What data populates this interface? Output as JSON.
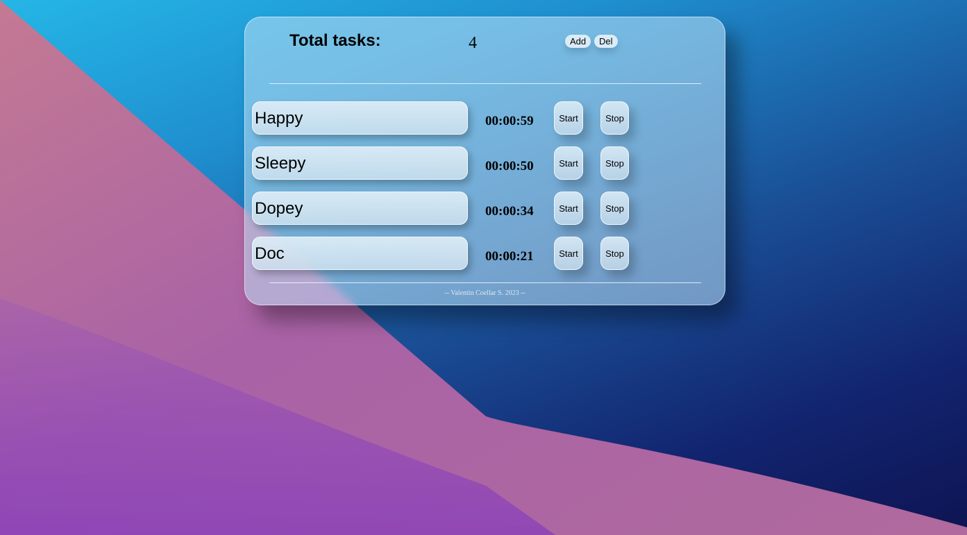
{
  "header": {
    "title": "Total tasks:",
    "count": "4",
    "add_label": "Add",
    "del_label": "Del"
  },
  "tasks": [
    {
      "name": "Happy",
      "time": "00:00:59",
      "start_label": "Start",
      "stop_label": "Stop"
    },
    {
      "name": "Sleepy",
      "time": "00:00:50",
      "start_label": "Start",
      "stop_label": "Stop"
    },
    {
      "name": "Dopey",
      "time": "00:00:34",
      "start_label": "Start",
      "stop_label": "Stop"
    },
    {
      "name": "Doc",
      "time": "00:00:21",
      "start_label": "Start",
      "stop_label": "Stop"
    }
  ],
  "footer": {
    "credit": "-- Valentin Coellar S. 2023 --"
  },
  "colors": {
    "background_top": "#25b6e6",
    "background_bottom": "#0e1452",
    "wallpaper_wave": "#b06aa0",
    "wallpaper_purple": "#7a2fc4"
  }
}
